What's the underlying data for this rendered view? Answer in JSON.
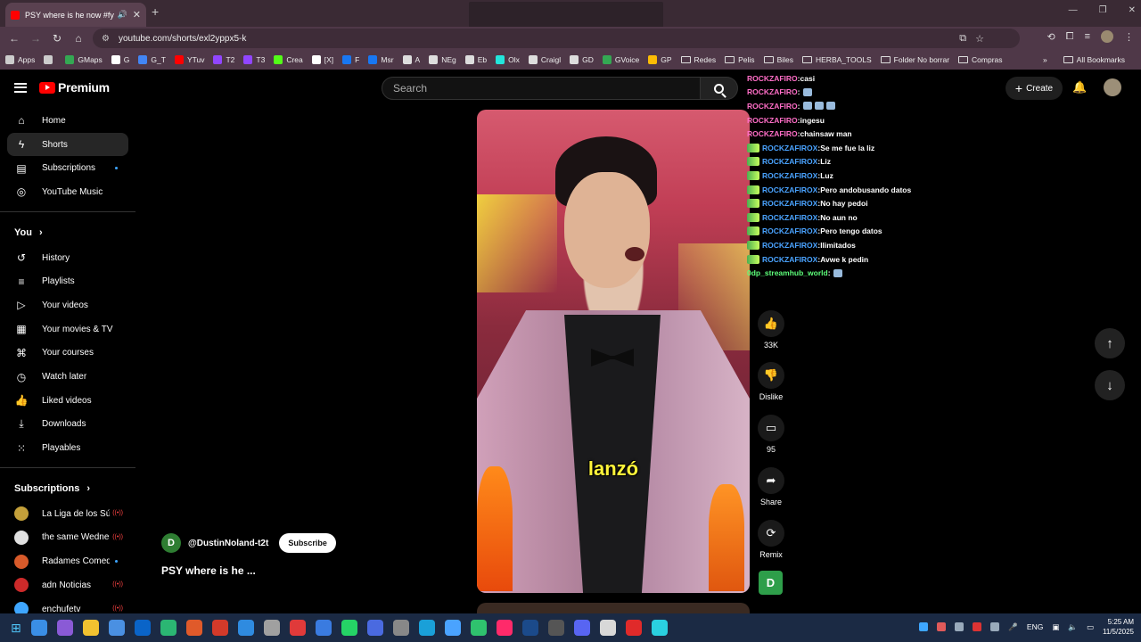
{
  "browser": {
    "tab_title": "PSY where is he now #fyp",
    "tab_close": "✕",
    "new_tab": "+",
    "url": "youtube.com/shorts/exl2yppx5-k",
    "window_controls": [
      "—",
      "❐",
      "✕"
    ]
  },
  "bookmarks": {
    "items": [
      {
        "label": "Apps",
        "icon": "apps-grid-icon",
        "color": "#cccccc"
      },
      {
        "label": "",
        "icon": "grid-icon",
        "color": "#cccccc"
      },
      {
        "label": "GMaps",
        "icon": "maps-icon",
        "color": "#34a853"
      },
      {
        "label": "G",
        "icon": "google-icon",
        "color": "#ffffff"
      },
      {
        "label": "G_T",
        "icon": "translate-icon",
        "color": "#4285f4"
      },
      {
        "label": "YTuv",
        "icon": "youtube-icon",
        "color": "#ff0000"
      },
      {
        "label": "T2",
        "icon": "twitch-icon",
        "color": "#9146ff"
      },
      {
        "label": "T3",
        "icon": "twitch-icon",
        "color": "#9146ff"
      },
      {
        "label": "Crea",
        "icon": "kick-icon",
        "color": "#53fc18"
      },
      {
        "label": "[X]",
        "icon": "x-icon",
        "color": "#ffffff"
      },
      {
        "label": "F",
        "icon": "facebook-icon",
        "color": "#1877f2"
      },
      {
        "label": "Msr",
        "icon": "facebook-icon",
        "color": "#1877f2"
      },
      {
        "label": "A",
        "icon": "bookmark-icon",
        "color": "#dddddd"
      },
      {
        "label": "NEg",
        "icon": "globe-icon",
        "color": "#dddddd"
      },
      {
        "label": "Eb",
        "icon": "globe-icon",
        "color": "#dddddd"
      },
      {
        "label": "Olx",
        "icon": "olx-icon",
        "color": "#23e5db"
      },
      {
        "label": "Craigl",
        "icon": "peace-icon",
        "color": "#dddddd"
      },
      {
        "label": "GD",
        "icon": "globe-icon",
        "color": "#dddddd"
      },
      {
        "label": "GVoice",
        "icon": "voice-icon",
        "color": "#34a853"
      },
      {
        "label": "GP",
        "icon": "photos-icon",
        "color": "#fbbc05"
      }
    ],
    "folders": [
      "Redes",
      "Pelis",
      "Biles",
      "HERBA_TOOLS",
      "Folder No borrar",
      "Compras"
    ],
    "more": "»",
    "all_bookmarks": "All Bookmarks"
  },
  "youtube": {
    "brand": "Premium",
    "search_placeholder": "Search",
    "create_label": "Create",
    "sidebar": {
      "main": [
        {
          "label": "Home",
          "icon": "home-icon",
          "glyph": "⌂"
        },
        {
          "label": "Shorts",
          "icon": "shorts-icon",
          "glyph": "ϟ"
        },
        {
          "label": "Subscriptions",
          "icon": "subscriptions-icon",
          "glyph": "▤"
        },
        {
          "label": "YouTube Music",
          "icon": "music-icon",
          "glyph": "◎"
        }
      ],
      "you_header": "You",
      "you": [
        {
          "label": "History",
          "icon": "history-icon",
          "glyph": "↺"
        },
        {
          "label": "Playlists",
          "icon": "playlists-icon",
          "glyph": "≡"
        },
        {
          "label": "Your videos",
          "icon": "your-videos-icon",
          "glyph": "▷"
        },
        {
          "label": "Your movies & TV",
          "icon": "movies-icon",
          "glyph": "▦"
        },
        {
          "label": "Your courses",
          "icon": "courses-icon",
          "glyph": "⌘"
        },
        {
          "label": "Watch later",
          "icon": "watch-later-icon",
          "glyph": "◷"
        },
        {
          "label": "Liked videos",
          "icon": "like-icon",
          "glyph": "👍"
        },
        {
          "label": "Downloads",
          "icon": "download-icon",
          "glyph": "⤓"
        },
        {
          "label": "Playables",
          "icon": "playables-icon",
          "glyph": "⁙"
        }
      ],
      "subs_header": "Subscriptions",
      "subscriptions": [
        {
          "label": "La Liga de los Sú...",
          "color": "#c4a03a",
          "live": "((•))"
        },
        {
          "label": "the same Wedne...",
          "color": "#e0e0e0",
          "live": "((•))"
        },
        {
          "label": "Radames Comedy",
          "color": "#d85a2a",
          "live": ""
        },
        {
          "label": "adn Noticias",
          "color": "#cc2a2a",
          "live": "((•))"
        },
        {
          "label": "enchufetv",
          "color": "#3ea6ff",
          "live": "((•))"
        }
      ]
    },
    "short": {
      "caption": "lanzó",
      "channel_initial": "D",
      "channel_name": "@DustinNoland-t2t",
      "subscribe_label": "Subscribe",
      "title": "PSY where is he ..."
    },
    "actions": {
      "like_count": "33K",
      "dislike_label": "Dislike",
      "comment_count": "95",
      "share_label": "Share",
      "remix_label": "Remix",
      "remix_initial": "D"
    }
  },
  "chat": [
    {
      "user": "ROCKZAFIRO",
      "msg": "casi",
      "style": "pink",
      "badge": false
    },
    {
      "user": "ROCKZAFIRO",
      "msg": "",
      "style": "pink",
      "badge": false,
      "emotes": 1
    },
    {
      "user": "ROCKZAFIRO",
      "msg": "",
      "style": "pink",
      "badge": false,
      "emotes": 3
    },
    {
      "user": "ROCKZAFIRO",
      "msg": "ingesu",
      "style": "pink",
      "badge": false
    },
    {
      "user": "ROCKZAFIRO",
      "msg": "chainsaw man",
      "style": "pink",
      "badge": false
    },
    {
      "user": "ROCKZAFIROX",
      "msg": "Se me fue la liz",
      "style": "blue",
      "badge": true
    },
    {
      "user": "ROCKZAFIROX",
      "msg": "Liz",
      "style": "blue",
      "badge": true
    },
    {
      "user": "ROCKZAFIROX",
      "msg": "Luz",
      "style": "blue",
      "badge": true
    },
    {
      "user": "ROCKZAFIROX",
      "msg": "Pero andobusando datos",
      "style": "blue",
      "badge": true
    },
    {
      "user": "ROCKZAFIROX",
      "msg": "No hay pedoi",
      "style": "blue",
      "badge": true
    },
    {
      "user": "ROCKZAFIROX",
      "msg": "No aun no",
      "style": "blue",
      "badge": true
    },
    {
      "user": "ROCKZAFIROX",
      "msg": "Pero tengo datos",
      "style": "blue",
      "badge": true
    },
    {
      "user": "ROCKZAFIROX",
      "msg": "Ilimitados",
      "style": "blue",
      "badge": true
    },
    {
      "user": "ROCKZAFIROX",
      "msg": "Avwe k pedin",
      "style": "blue",
      "badge": true
    },
    {
      "user": "0dp_streamhub_world",
      "msg": "",
      "style": "green",
      "badge": false,
      "emotes": 1
    }
  ],
  "taskbar": {
    "apps": [
      "#3a8ee6",
      "#8a5ad6",
      "#f2c230",
      "#4a90e2",
      "#0a64c8",
      "#2bb673",
      "#e05a2a",
      "#d33a2a",
      "#2f8be0",
      "#a0a0a0",
      "#e03a3a",
      "#3a7be0",
      "#25d366",
      "#4a6ae0",
      "#888888",
      "#1aa0d8",
      "#4aa3ff",
      "#2fc26e",
      "#ff2a6a",
      "#1b4a8a",
      "#555555",
      "#5865f2",
      "#d8d8d8",
      "#e02a2a",
      "#2ad0e0"
    ],
    "tray_lang": "ENG",
    "time": "5:25 AM",
    "date": "11/5/2025"
  }
}
